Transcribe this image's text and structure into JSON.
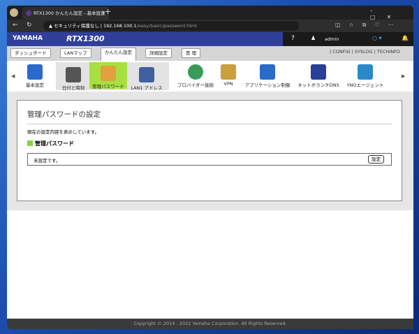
{
  "browser": {
    "tab_title": "RTX1300 かんたん設定 - 基本設定",
    "security": "セキュリティ保護なし",
    "url_host": "192.168.100.1",
    "url_path": "/easy/basic/password.html"
  },
  "header": {
    "brand": "YAMAHA",
    "model": "RTX1300",
    "help": "?",
    "user": "admin"
  },
  "nav": {
    "tabs": [
      "ダッシュボード",
      "LANマップ",
      "かんたん設定",
      "詳細設定",
      "管 理"
    ],
    "links": [
      "CONFIG",
      "SYSLOG",
      "TECHINFO"
    ]
  },
  "menu": {
    "items": [
      {
        "label": "基本設定",
        "color": "#2a6ac8"
      },
      {
        "label": "日付と時刻",
        "color": "#555555"
      },
      {
        "label": "管理パスワード",
        "color": "#e0a040"
      },
      {
        "label": "LAN1 アドレス",
        "color": "#4060a0"
      },
      {
        "label": "プロバイダー接続",
        "color": "#3a9a5a"
      },
      {
        "label": "VPN",
        "color": "#c8a040"
      },
      {
        "label": "アプリケーション制御",
        "color": "#2a6ac8"
      },
      {
        "label": "ネットボランチDNS",
        "color": "#2a3f9a"
      },
      {
        "label": "YNOエージェント",
        "color": "#2a8ac8"
      }
    ]
  },
  "page": {
    "title": "管理パスワードの設定",
    "description": "現在の設定内容を表示しています。",
    "section": "管理パスワード",
    "status": "未設定です。",
    "set_button": "設定"
  },
  "footer": "Copyright © 2014 - 2022 Yamaha Corporation. All Rights Reserved."
}
